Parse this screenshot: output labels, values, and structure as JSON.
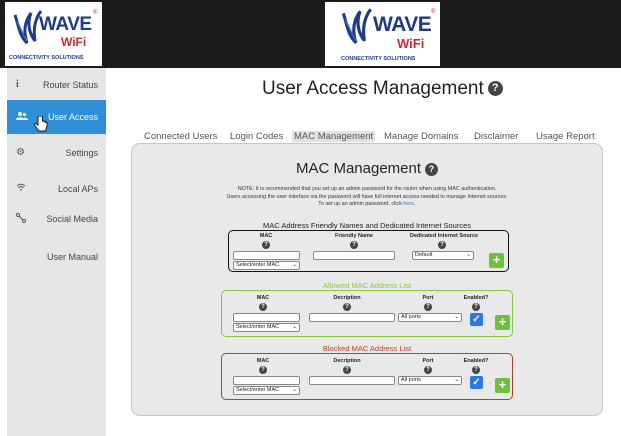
{
  "brand": {
    "wave": "WAVE",
    "wifi": "WiFi",
    "reg": "®",
    "tagline": "CONNECTIVITY SOLUTIONS"
  },
  "sidebar": {
    "items": [
      {
        "icon": "info-icon",
        "glyph": "i",
        "label": "Router Status"
      },
      {
        "icon": "users-icon",
        "glyph": "👥",
        "label": "User Access"
      },
      {
        "icon": "gears-icon",
        "glyph": "⚙",
        "label": "Settings"
      },
      {
        "icon": "wifi-icon",
        "glyph": "≋",
        "label": "Local APs"
      },
      {
        "icon": "share-icon",
        "glyph": "⚯",
        "label": "Social Media"
      },
      {
        "icon": "",
        "glyph": "",
        "label": "User Manual"
      }
    ],
    "active_index": 1
  },
  "page": {
    "title": "User Access Management",
    "help_glyph": "?"
  },
  "tabs": [
    {
      "label": "Connected Users"
    },
    {
      "label": "Login Codes"
    },
    {
      "label": "MAC Management",
      "active": true
    },
    {
      "label": "Manage Domains"
    },
    {
      "label": "Disclaimer"
    },
    {
      "label": "Usage Report"
    }
  ],
  "panel": {
    "title": "MAC Management",
    "note_line1": "NOTE: It is recommended that you set up an admin password for the router when using MAC authentication.",
    "note_line2": "Users accessing the user interface via the password will have full internet access needed to manage Internet sources.",
    "note_line3_prefix": "To set up an admin password, click ",
    "note_link": "here."
  },
  "friendly": {
    "title": "MAC Address Friendly Names and Dedicated Internet Sources",
    "col_mac": "MAC",
    "col_name": "Friendly Name",
    "col_source": "Dedicated Internet Source",
    "mac_select": "Select/enter MAC",
    "source_select": "Default",
    "add": "+"
  },
  "allowed": {
    "title": "Allowed MAC Address List",
    "col_mac": "MAC",
    "col_desc": "Decription",
    "col_port": "Port",
    "col_enabled": "Enabled?",
    "mac_select": "Select/enter MAC",
    "port_select": "All ports",
    "enabled": true,
    "add": "+"
  },
  "blocked": {
    "title": "Blocked MAC Address List",
    "col_mac": "MAC",
    "col_desc": "Decription",
    "col_port": "Port",
    "col_enabled": "Enabled?",
    "mac_select": "Select/enter MAC",
    "port_select": "All ports",
    "enabled": true,
    "add": "+"
  },
  "colors": {
    "accent": "#2f8fd6",
    "allowed": "#8cc63f",
    "blocked": "#c0392b",
    "add_button": "#6fbf3b",
    "checkbox": "#2b78e4"
  }
}
